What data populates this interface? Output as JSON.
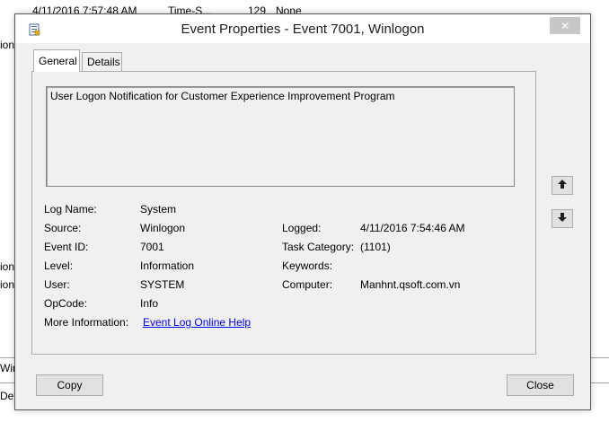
{
  "background": {
    "top_row": {
      "date": "4/11/2016 7:57:48 AM",
      "category": "Time-S...",
      "event_id": "129",
      "task": "None"
    },
    "left_fragments": [
      "ion",
      "ion",
      "ion"
    ],
    "bottom_fragments": [
      "Win",
      "Deta"
    ]
  },
  "dialog": {
    "title": "Event Properties - Event 7001, Winlogon",
    "close_glyph": "✕",
    "tabs": [
      {
        "label": "General"
      },
      {
        "label": "Details"
      }
    ],
    "description": "User Logon Notification for Customer Experience Improvement Program",
    "fields": {
      "log_name": {
        "label": "Log Name:",
        "value": "System"
      },
      "source": {
        "label": "Source:",
        "value": "Winlogon"
      },
      "event_id": {
        "label": "Event ID:",
        "value": "7001"
      },
      "level": {
        "label": "Level:",
        "value": "Information"
      },
      "user": {
        "label": "User:",
        "value": "SYSTEM"
      },
      "opcode": {
        "label": "OpCode:",
        "value": "Info"
      },
      "more_info": {
        "label": "More Information:",
        "value": "Event Log Online Help"
      },
      "logged": {
        "label": "Logged:",
        "value": "4/11/2016 7:54:46 AM"
      },
      "task_category": {
        "label": "Task Category:",
        "value": "(1101)"
      },
      "keywords": {
        "label": "Keywords:",
        "value": ""
      },
      "computer": {
        "label": "Computer:",
        "value": "Manhnt.qsoft.com.vn"
      }
    },
    "buttons": {
      "copy": "Copy",
      "close": "Close"
    }
  }
}
